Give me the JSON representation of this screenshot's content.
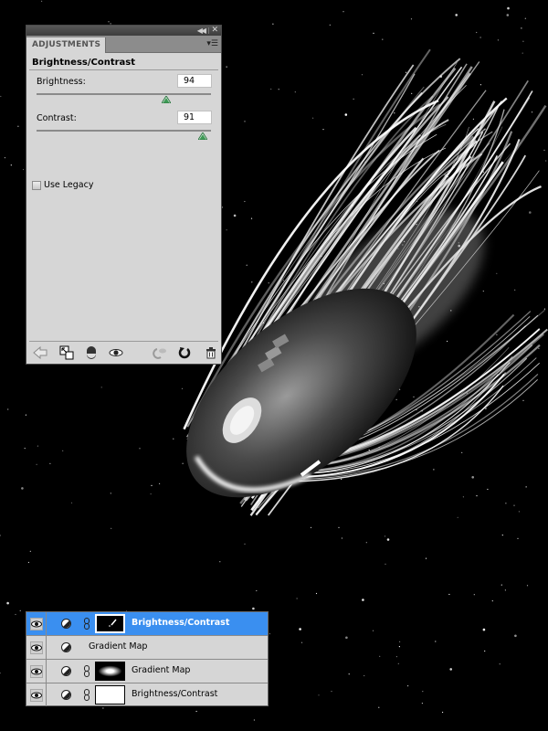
{
  "adjustments_panel": {
    "tab_label": "ADJUSTMENTS",
    "heading": "Brightness/Contrast",
    "sliders": [
      {
        "label": "Brightness:",
        "value": "94",
        "position_fraction": 0.745
      },
      {
        "label": "Contrast:",
        "value": "91",
        "position_fraction": 0.955
      }
    ],
    "use_legacy": {
      "label": "Use Legacy",
      "checked": false
    },
    "footer_icons": [
      "back-arrow-icon",
      "clip-to-layer-icon",
      "layer-mask-icon",
      "visibility-eye-icon",
      "view-previous-state-icon",
      "reset-icon",
      "delete-icon"
    ]
  },
  "layers_panel": {
    "rows": [
      {
        "name": "Brightness/Contrast",
        "selected": true,
        "has_mask": true,
        "mask": "dark-with-mark"
      },
      {
        "name": "Gradient Map",
        "selected": false,
        "has_mask": false,
        "mask": "none"
      },
      {
        "name": "Gradient Map",
        "selected": false,
        "has_mask": true,
        "mask": "dark-with-glow"
      },
      {
        "name": "Brightness/Contrast",
        "selected": false,
        "has_mask": true,
        "mask": "white"
      }
    ]
  },
  "colors": {
    "panel_bg": "#d6d6d6",
    "selection": "#3a8ff0",
    "slider_thumb": "#3d9a55",
    "canvas_bg": "#000000"
  },
  "canvas": {
    "subject": "computer mouse with white light streaks over starfield"
  }
}
